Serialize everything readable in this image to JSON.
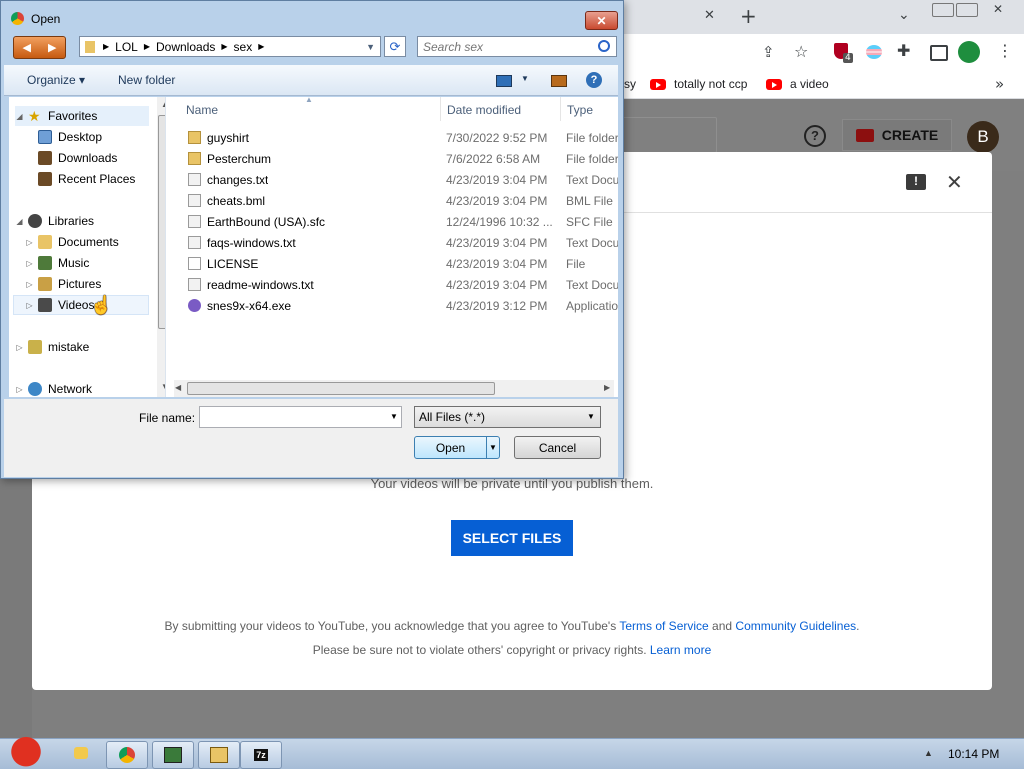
{
  "browser": {
    "tab_close": "✕",
    "new_tab": "+",
    "bookmarks": [
      {
        "label": "sy"
      },
      {
        "label": "totally not ccp"
      },
      {
        "label": "a video"
      }
    ],
    "extension_badge": "4",
    "more_bookmarks": "»"
  },
  "youtube": {
    "help": "?",
    "create_label": "CREATE",
    "avatar_letter": "B",
    "modal": {
      "feedback_icon": "!",
      "close": "✕",
      "privacy_note": "Your videos will be private until you publish them.",
      "select_files_label": "SELECT FILES",
      "terms_prefix": "By submitting your videos to YouTube, you acknowledge that you agree to YouTube's ",
      "terms_link": "Terms of Service",
      "terms_and": " and ",
      "guidelines_link": "Community Guidelines",
      "terms_suffix": ".",
      "privacy_prefix": "Please be sure not to violate others' copyright or privacy rights. ",
      "learn_more_link": "Learn more"
    }
  },
  "dialog": {
    "title": "Open",
    "close": "✕",
    "breadcrumb": [
      "LOL",
      "Downloads",
      "sex"
    ],
    "search_placeholder": "Search sex",
    "organize_label": "Organize ▾",
    "new_folder_label": "New folder",
    "nav": {
      "favorites": "Favorites",
      "desktop": "Desktop",
      "downloads": "Downloads",
      "recent_places": "Recent Places",
      "libraries": "Libraries",
      "documents": "Documents",
      "music": "Music",
      "pictures": "Pictures",
      "videos": "Videos",
      "mistake": "mistake",
      "network": "Network"
    },
    "columns": {
      "name": "Name",
      "date": "Date modified",
      "type": "Type"
    },
    "files": [
      {
        "name": "guyshirt",
        "date": "7/30/2022 9:52 PM",
        "type": "File folder"
      },
      {
        "name": "Pesterchum",
        "date": "7/6/2022 6:58 AM",
        "type": "File folder"
      },
      {
        "name": "changes.txt",
        "date": "4/23/2019 3:04 PM",
        "type": "Text Document"
      },
      {
        "name": "cheats.bml",
        "date": "4/23/2019 3:04 PM",
        "type": "BML File"
      },
      {
        "name": "EarthBound (USA).sfc",
        "date": "12/24/1996 10:32 ...",
        "type": "SFC File"
      },
      {
        "name": "faqs-windows.txt",
        "date": "4/23/2019 3:04 PM",
        "type": "Text Document"
      },
      {
        "name": "LICENSE",
        "date": "4/23/2019 3:04 PM",
        "type": "File"
      },
      {
        "name": "readme-windows.txt",
        "date": "4/23/2019 3:04 PM",
        "type": "Text Document"
      },
      {
        "name": "snes9x-x64.exe",
        "date": "4/23/2019 3:12 PM",
        "type": "Application"
      }
    ],
    "file_name_label": "File name:",
    "file_name_value": "",
    "filter_label": "All Files (*.*)",
    "open_label": "Open",
    "cancel_label": "Cancel"
  },
  "taskbar": {
    "clock": "10:14 PM",
    "tasks": [
      "7z"
    ]
  }
}
